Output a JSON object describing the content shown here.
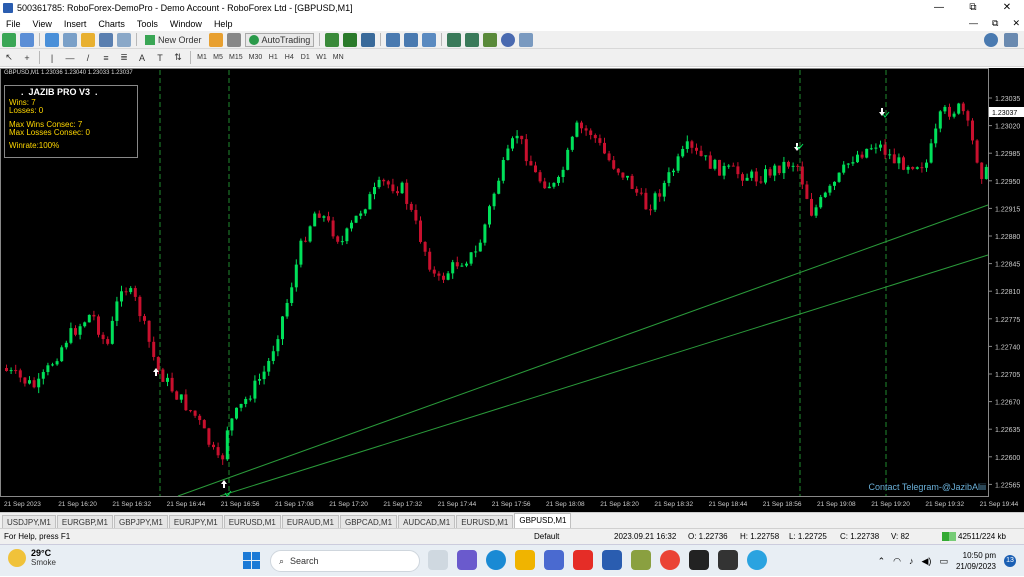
{
  "window": {
    "title": "500361785: RoboForex-DemoPro - Demo Account - RoboForex Ltd - [GBPUSD,M1]",
    "controls": [
      "—",
      "⧉",
      "✕"
    ]
  },
  "menu": {
    "items": [
      "File",
      "View",
      "Insert",
      "Charts",
      "Tools",
      "Window",
      "Help"
    ],
    "mdi_controls": [
      "—",
      "⧉",
      "✕"
    ]
  },
  "toolbar": {
    "new_order": "New Order",
    "autotrading": "AutoTrading",
    "timeframes": [
      "M1",
      "M5",
      "M15",
      "M30",
      "H1",
      "H4",
      "D1",
      "W1",
      "MN"
    ]
  },
  "chart": {
    "header": "GBPUSD,M1  1.23036 1.23040 1.23033 1.23037",
    "price_labels": [
      "1.23035",
      "1.23020",
      "1.22985",
      "1.22950",
      "1.22915",
      "1.22880",
      "1.22845",
      "1.22810",
      "1.22775",
      "1.22740",
      "1.22705",
      "1.22670",
      "1.22635",
      "1.22600",
      "1.22565"
    ],
    "current_price": "1.23037",
    "time_labels": [
      "21 Sep 2023",
      "21 Sep 16:20",
      "21 Sep 16:32",
      "21 Sep 16:44",
      "21 Sep 16:56",
      "21 Sep 17:08",
      "21 Sep 17:20",
      "21 Sep 17:32",
      "21 Sep 17:44",
      "21 Sep 17:56",
      "21 Sep 18:08",
      "21 Sep 18:20",
      "21 Sep 18:32",
      "21 Sep 18:44",
      "21 Sep 18:56",
      "21 Sep 19:08",
      "21 Sep 19:20",
      "21 Sep 19:32",
      "21 Sep 19:44"
    ],
    "up_color": "#00e05a",
    "down_color": "#c8102e",
    "contact": "Contact Telegram-@JazibAliii"
  },
  "panel": {
    "title": "JAZIB PRO V3",
    "wins": "Wins: 7",
    "losses": "Losses: 0",
    "max_wins": "Max Wins Consec: 7",
    "max_losses": "Max Losses Consec: 0",
    "winrate": "Winrate:100%"
  },
  "tabs": [
    "USDJPY,M1",
    "EURGBP,M1",
    "GBPJPY,M1",
    "EURJPY,M1",
    "EURUSD,M1",
    "EURAUD,M1",
    "GBPCAD,M1",
    "AUDCAD,M1",
    "EURUSD,M1",
    "GBPUSD,M1"
  ],
  "status": {
    "help": "For Help, press F1",
    "profile": "Default",
    "datetime": "2023.09.21 16:32",
    "open": "O: 1.22736",
    "high": "H: 1.22758",
    "low": "L: 1.22725",
    "close": "C: 1.22738",
    "volume": "V: 82",
    "traffic": "42511/224 kb"
  },
  "taskbar": {
    "temp": "29°C",
    "weather": "Smoke",
    "search": "Search",
    "time": "10:50 pm",
    "date": "21/09/2023",
    "notifications": "13"
  }
}
